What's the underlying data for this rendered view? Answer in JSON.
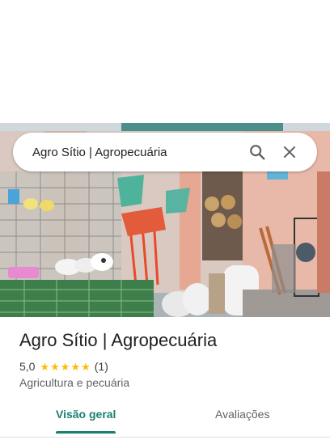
{
  "search": {
    "query": "Agro Sítio | Agropecuária"
  },
  "place": {
    "name": "Agro Sítio | Agropecuária",
    "rating": "5,0",
    "stars": 5,
    "review_count": "(1)",
    "category": "Agricultura e pecuária"
  },
  "tabs": [
    {
      "label": "Visão geral",
      "active": true
    },
    {
      "label": "Avaliações",
      "active": false
    }
  ],
  "colors": {
    "accent": "#1a7f72",
    "star": "#fbbc04"
  },
  "icons": {
    "search": "search-icon",
    "close": "close-icon",
    "star": "star-icon"
  }
}
